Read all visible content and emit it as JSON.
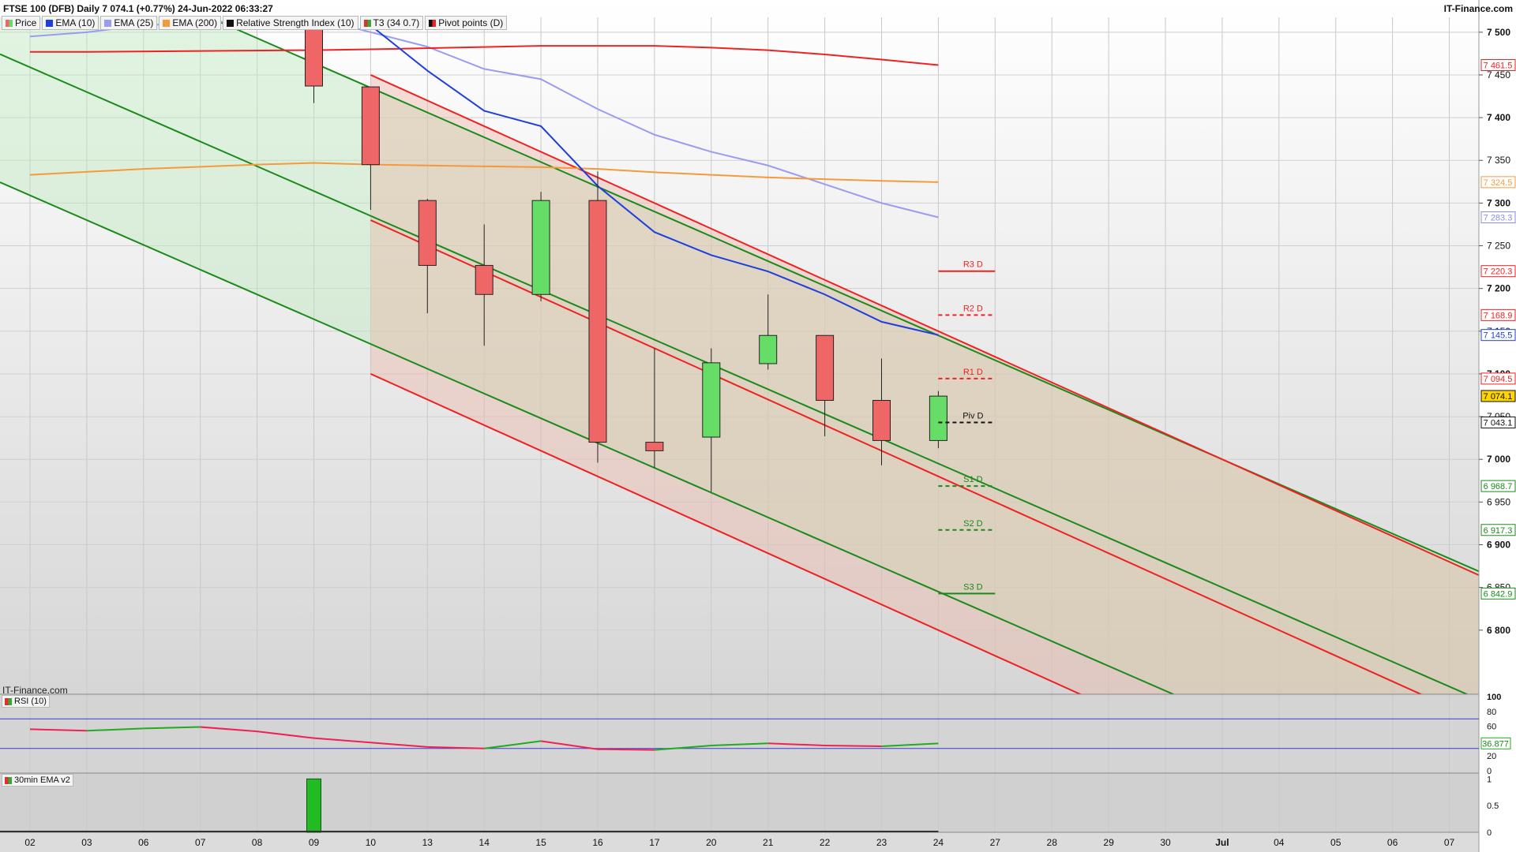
{
  "header": {
    "title": "FTSE 100 (DFB) Daily 7 074.1 (+0.77%) 24-Jun-2022 06:33:27",
    "brand": "IT-Finance.com",
    "watermark": "IT-Finance.com"
  },
  "legend": [
    {
      "label": "Price",
      "color": "#33aa33",
      "icon": "candle-icon"
    },
    {
      "label": "EMA (10)",
      "color": "#1f3fdd",
      "icon": "square-icon"
    },
    {
      "label": "EMA (25)",
      "color": "#9a9cf0",
      "icon": "square-icon"
    },
    {
      "label": "EMA (200)",
      "color": "#f59a3c",
      "icon": "square-icon"
    },
    {
      "label": "Relative Strength Index (10)",
      "color": "#111111",
      "icon": "square-icon"
    },
    {
      "label": "T3 (34 0.7)",
      "color": "#e03030",
      "icon": "square-icon"
    },
    {
      "label": "Pivot points (D)",
      "color": "#111111",
      "icon": "square-icon"
    }
  ],
  "panels": {
    "rsi_label": "RSI (10)",
    "ema30_label": "30min EMA v2"
  },
  "colors": {
    "up": "#66dd66",
    "down": "#ee6666",
    "ema10": "#1f3fdd",
    "ema25": "#9a9cf0",
    "ema200": "#f59a3c",
    "red_channel": "#ee2222",
    "green_channel": "#1a8a1a"
  },
  "chart_data": {
    "type": "candlestick",
    "x_ticks": [
      "02",
      "03",
      "06",
      "07",
      "08",
      "09",
      "10",
      "13",
      "14",
      "15",
      "16",
      "17",
      "20",
      "21",
      "22",
      "23",
      "24",
      "27",
      "28",
      "29",
      "30",
      "Jul",
      "04",
      "05",
      "06",
      "07"
    ],
    "y_ticks": [
      {
        "value": 7500,
        "label": "7 500"
      },
      {
        "value": 7450,
        "label": "7 450"
      },
      {
        "value": 7400,
        "label": "7 400"
      },
      {
        "value": 7350,
        "label": "7 350"
      },
      {
        "value": 7300,
        "label": "7 300"
      },
      {
        "value": 7250,
        "label": "7 250"
      },
      {
        "value": 7200,
        "label": "7 200"
      },
      {
        "value": 7150,
        "label": "7 150"
      },
      {
        "value": 7100,
        "label": "7 100"
      },
      {
        "value": 7050,
        "label": "7 050"
      },
      {
        "value": 7000,
        "label": "7 000"
      },
      {
        "value": 6950,
        "label": "6 950"
      },
      {
        "value": 6900,
        "label": "6 900"
      },
      {
        "value": 6850,
        "label": "6 850"
      },
      {
        "value": 6800,
        "label": "6 800"
      }
    ],
    "ylim": [
      6725,
      7510
    ],
    "candles": [
      {
        "date": "09",
        "open": 7510,
        "high": 7510,
        "low": 7417,
        "close": 7437
      },
      {
        "date": "10",
        "open": 7436,
        "high": 7436,
        "low": 7292,
        "close": 7345
      },
      {
        "date": "13",
        "open": 7303,
        "high": 7305,
        "low": 7171,
        "close": 7227
      },
      {
        "date": "14",
        "open": 7227,
        "high": 7275,
        "low": 7133,
        "close": 7193
      },
      {
        "date": "15",
        "open": 7193,
        "high": 7313,
        "low": 7185,
        "close": 7303
      },
      {
        "date": "16",
        "open": 7303,
        "high": 7337,
        "low": 6996,
        "close": 7020
      },
      {
        "date": "17",
        "open": 7020,
        "high": 7130,
        "low": 6990,
        "close": 7010
      },
      {
        "date": "20",
        "open": 7026,
        "high": 7130,
        "low": 6962,
        "close": 7113
      },
      {
        "date": "21",
        "open": 7112,
        "high": 7193,
        "low": 7105,
        "close": 7145
      },
      {
        "date": "22",
        "open": 7145,
        "high": 7145,
        "low": 7027,
        "close": 7069
      },
      {
        "date": "23",
        "open": 7069,
        "high": 7118,
        "low": 6993,
        "close": 7022
      },
      {
        "date": "24",
        "open": 7022,
        "high": 7080,
        "low": 7013,
        "close": 7074
      }
    ],
    "ema10": [
      [
        "03",
        7580
      ],
      [
        "09",
        7580
      ],
      [
        "10",
        7508
      ],
      [
        "13",
        7455
      ],
      [
        "14",
        7408
      ],
      [
        "15",
        7390
      ],
      [
        "16",
        7320
      ],
      [
        "17",
        7266
      ],
      [
        "20",
        7239
      ],
      [
        "21",
        7220
      ],
      [
        "22",
        7193
      ],
      [
        "23",
        7161
      ],
      [
        "24",
        7145.5
      ]
    ],
    "ema25": [
      [
        "02",
        7495
      ],
      [
        "03",
        7500
      ],
      [
        "06",
        7508
      ],
      [
        "09",
        7517
      ],
      [
        "10",
        7500
      ],
      [
        "13",
        7483
      ],
      [
        "14",
        7457
      ],
      [
        "15",
        7445
      ],
      [
        "16",
        7410
      ],
      [
        "17",
        7380
      ],
      [
        "20",
        7360
      ],
      [
        "21",
        7344
      ],
      [
        "22",
        7322
      ],
      [
        "23",
        7300
      ],
      [
        "24",
        7283.3
      ]
    ],
    "ema200": [
      [
        "02",
        7333
      ],
      [
        "06",
        7340
      ],
      [
        "08",
        7345
      ],
      [
        "09",
        7347
      ],
      [
        "10",
        7345
      ],
      [
        "14",
        7343
      ],
      [
        "15",
        7342
      ],
      [
        "16",
        7340
      ],
      [
        "17",
        7336
      ],
      [
        "20",
        7333
      ],
      [
        "21",
        7330
      ],
      [
        "22",
        7328
      ],
      [
        "23",
        7326
      ],
      [
        "24",
        7324.5
      ]
    ],
    "t3": [
      [
        "02",
        7477
      ],
      [
        "03",
        7477
      ],
      [
        "09",
        7479
      ],
      [
        "10",
        7480
      ],
      [
        "15",
        7484
      ],
      [
        "16",
        7484
      ],
      [
        "17",
        7484
      ],
      [
        "20",
        7482
      ],
      [
        "21",
        7479
      ],
      [
        "22",
        7474
      ],
      [
        "23",
        7468
      ],
      [
        "24",
        7461.5
      ]
    ],
    "pivots": [
      {
        "label": "R3 D",
        "value": 7220.3,
        "style": "solid",
        "color": "#ee2222"
      },
      {
        "label": "R2 D",
        "value": 7168.9,
        "style": "dashed",
        "color": "#ee2222"
      },
      {
        "label": "R1 D",
        "value": 7094.5,
        "style": "dashed",
        "color": "#ee2222"
      },
      {
        "label": "Piv D",
        "value": 7043.1,
        "style": "dashed",
        "color": "#111111"
      },
      {
        "label": "S1 D",
        "value": 6968.7,
        "style": "dashed",
        "color": "#1a8a1a"
      },
      {
        "label": "S2 D",
        "value": 6917.3,
        "style": "dashed",
        "color": "#1a8a1a"
      },
      {
        "label": "S3 D",
        "value": 6842.9,
        "style": "solid",
        "color": "#1a8a1a"
      }
    ],
    "price_labels": [
      {
        "label": "7 461.5",
        "value": 7461.5,
        "color": "#ee2222"
      },
      {
        "label": "7 324.5",
        "value": 7324.5,
        "color": "#f59a3c"
      },
      {
        "label": "7 283.3",
        "value": 7283.3,
        "color": "#8a8ce0"
      },
      {
        "label": "7 220.3",
        "value": 7220.3,
        "color": "#ee2222"
      },
      {
        "label": "7 168.9",
        "value": 7168.9,
        "color": "#ee2222"
      },
      {
        "label": "7 145.5",
        "value": 7145.5,
        "color": "#1f3fdd"
      },
      {
        "label": "7 094.5",
        "value": 7094.5,
        "color": "#ee2222"
      },
      {
        "label": "7 074.1",
        "value": 7074.1,
        "color": "#111111",
        "highlight": true
      },
      {
        "label": "7 043.1",
        "value": 7043.1,
        "color": "#111111"
      },
      {
        "label": "6 968.7",
        "value": 6968.7,
        "color": "#1a8a1a"
      },
      {
        "label": "6 917.3",
        "value": 6917.3,
        "color": "#1a8a1a"
      },
      {
        "label": "6 842.9",
        "value": 6842.9,
        "color": "#1a8a1a"
      }
    ],
    "channels": {
      "red": {
        "lines": [
          [
            [
              "10",
              7450
            ],
            [
              "Jul",
              7000
            ],
            [
              "07",
              6874
            ]
          ],
          [
            [
              "10",
              7280
            ],
            [
              "Jul",
              6830
            ],
            [
              "07",
              6704
            ]
          ],
          [
            [
              "10",
              7100
            ],
            [
              "Jul",
              6650
            ],
            [
              "07",
              6524
            ]
          ]
        ],
        "shade_from": "10"
      },
      "green": {
        "lines": [
          [
            [
              "03",
              7580
            ],
            [
              "Jul",
              7000
            ],
            [
              "07",
              6838
            ]
          ],
          [
            [
              "03",
              7430
            ],
            [
              "Jul",
              6850
            ],
            [
              "07",
              6688
            ]
          ],
          [
            [
              "03",
              7280
            ],
            [
              "Jul",
              6700
            ],
            [
              "07",
              6538
            ]
          ]
        ]
      }
    },
    "rsi": {
      "ylim": [
        0,
        100
      ],
      "ticks": [
        {
          "value": 100,
          "label": "100"
        },
        {
          "value": 80,
          "label": "80"
        },
        {
          "value": 60,
          "label": "60"
        },
        {
          "value": 20,
          "label": "20"
        },
        {
          "value": 0,
          "label": "0"
        }
      ],
      "levels": [
        70,
        30
      ],
      "values": [
        [
          "02",
          56
        ],
        [
          "03",
          54
        ],
        [
          "06",
          57
        ],
        [
          "07",
          59
        ],
        [
          "08",
          53
        ],
        [
          "09",
          44
        ],
        [
          "10",
          38
        ],
        [
          "13",
          32
        ],
        [
          "14",
          30
        ],
        [
          "15",
          40
        ],
        [
          "16",
          29
        ],
        [
          "17",
          28
        ],
        [
          "20",
          34
        ],
        [
          "21",
          37
        ],
        [
          "22",
          34
        ],
        [
          "23",
          33
        ],
        [
          "24",
          36.877
        ]
      ],
      "last_label": "36.877"
    },
    "ema30": {
      "ylim": [
        0,
        1.05
      ],
      "ticks": [
        {
          "value": 1,
          "label": "1"
        },
        {
          "value": 0.5,
          "label": "0.5"
        },
        {
          "value": 0,
          "label": "0"
        }
      ],
      "bars": [
        [
          "09",
          1
        ]
      ]
    }
  }
}
